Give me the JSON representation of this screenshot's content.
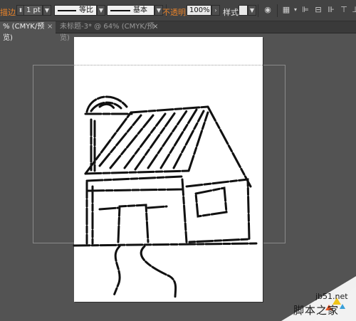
{
  "toolbar": {
    "stroke_label": "描边",
    "stroke_weight": "1 pt",
    "profile_label": "等比",
    "brush_label": "基本",
    "opacity_label": "不透明度",
    "opacity_value": "100%",
    "style_label": "样式"
  },
  "tabs": [
    {
      "label": "% (CMYK/预览)",
      "active": true
    },
    {
      "label": "未标题-3* @ 64% (CMYK/预览)",
      "active": false
    }
  ],
  "watermark": {
    "url": "jb51.net",
    "name": "脚本之家"
  },
  "colors": {
    "accent_orange": "#e8832a",
    "pasteboard": "#535353",
    "panel": "#434343"
  }
}
